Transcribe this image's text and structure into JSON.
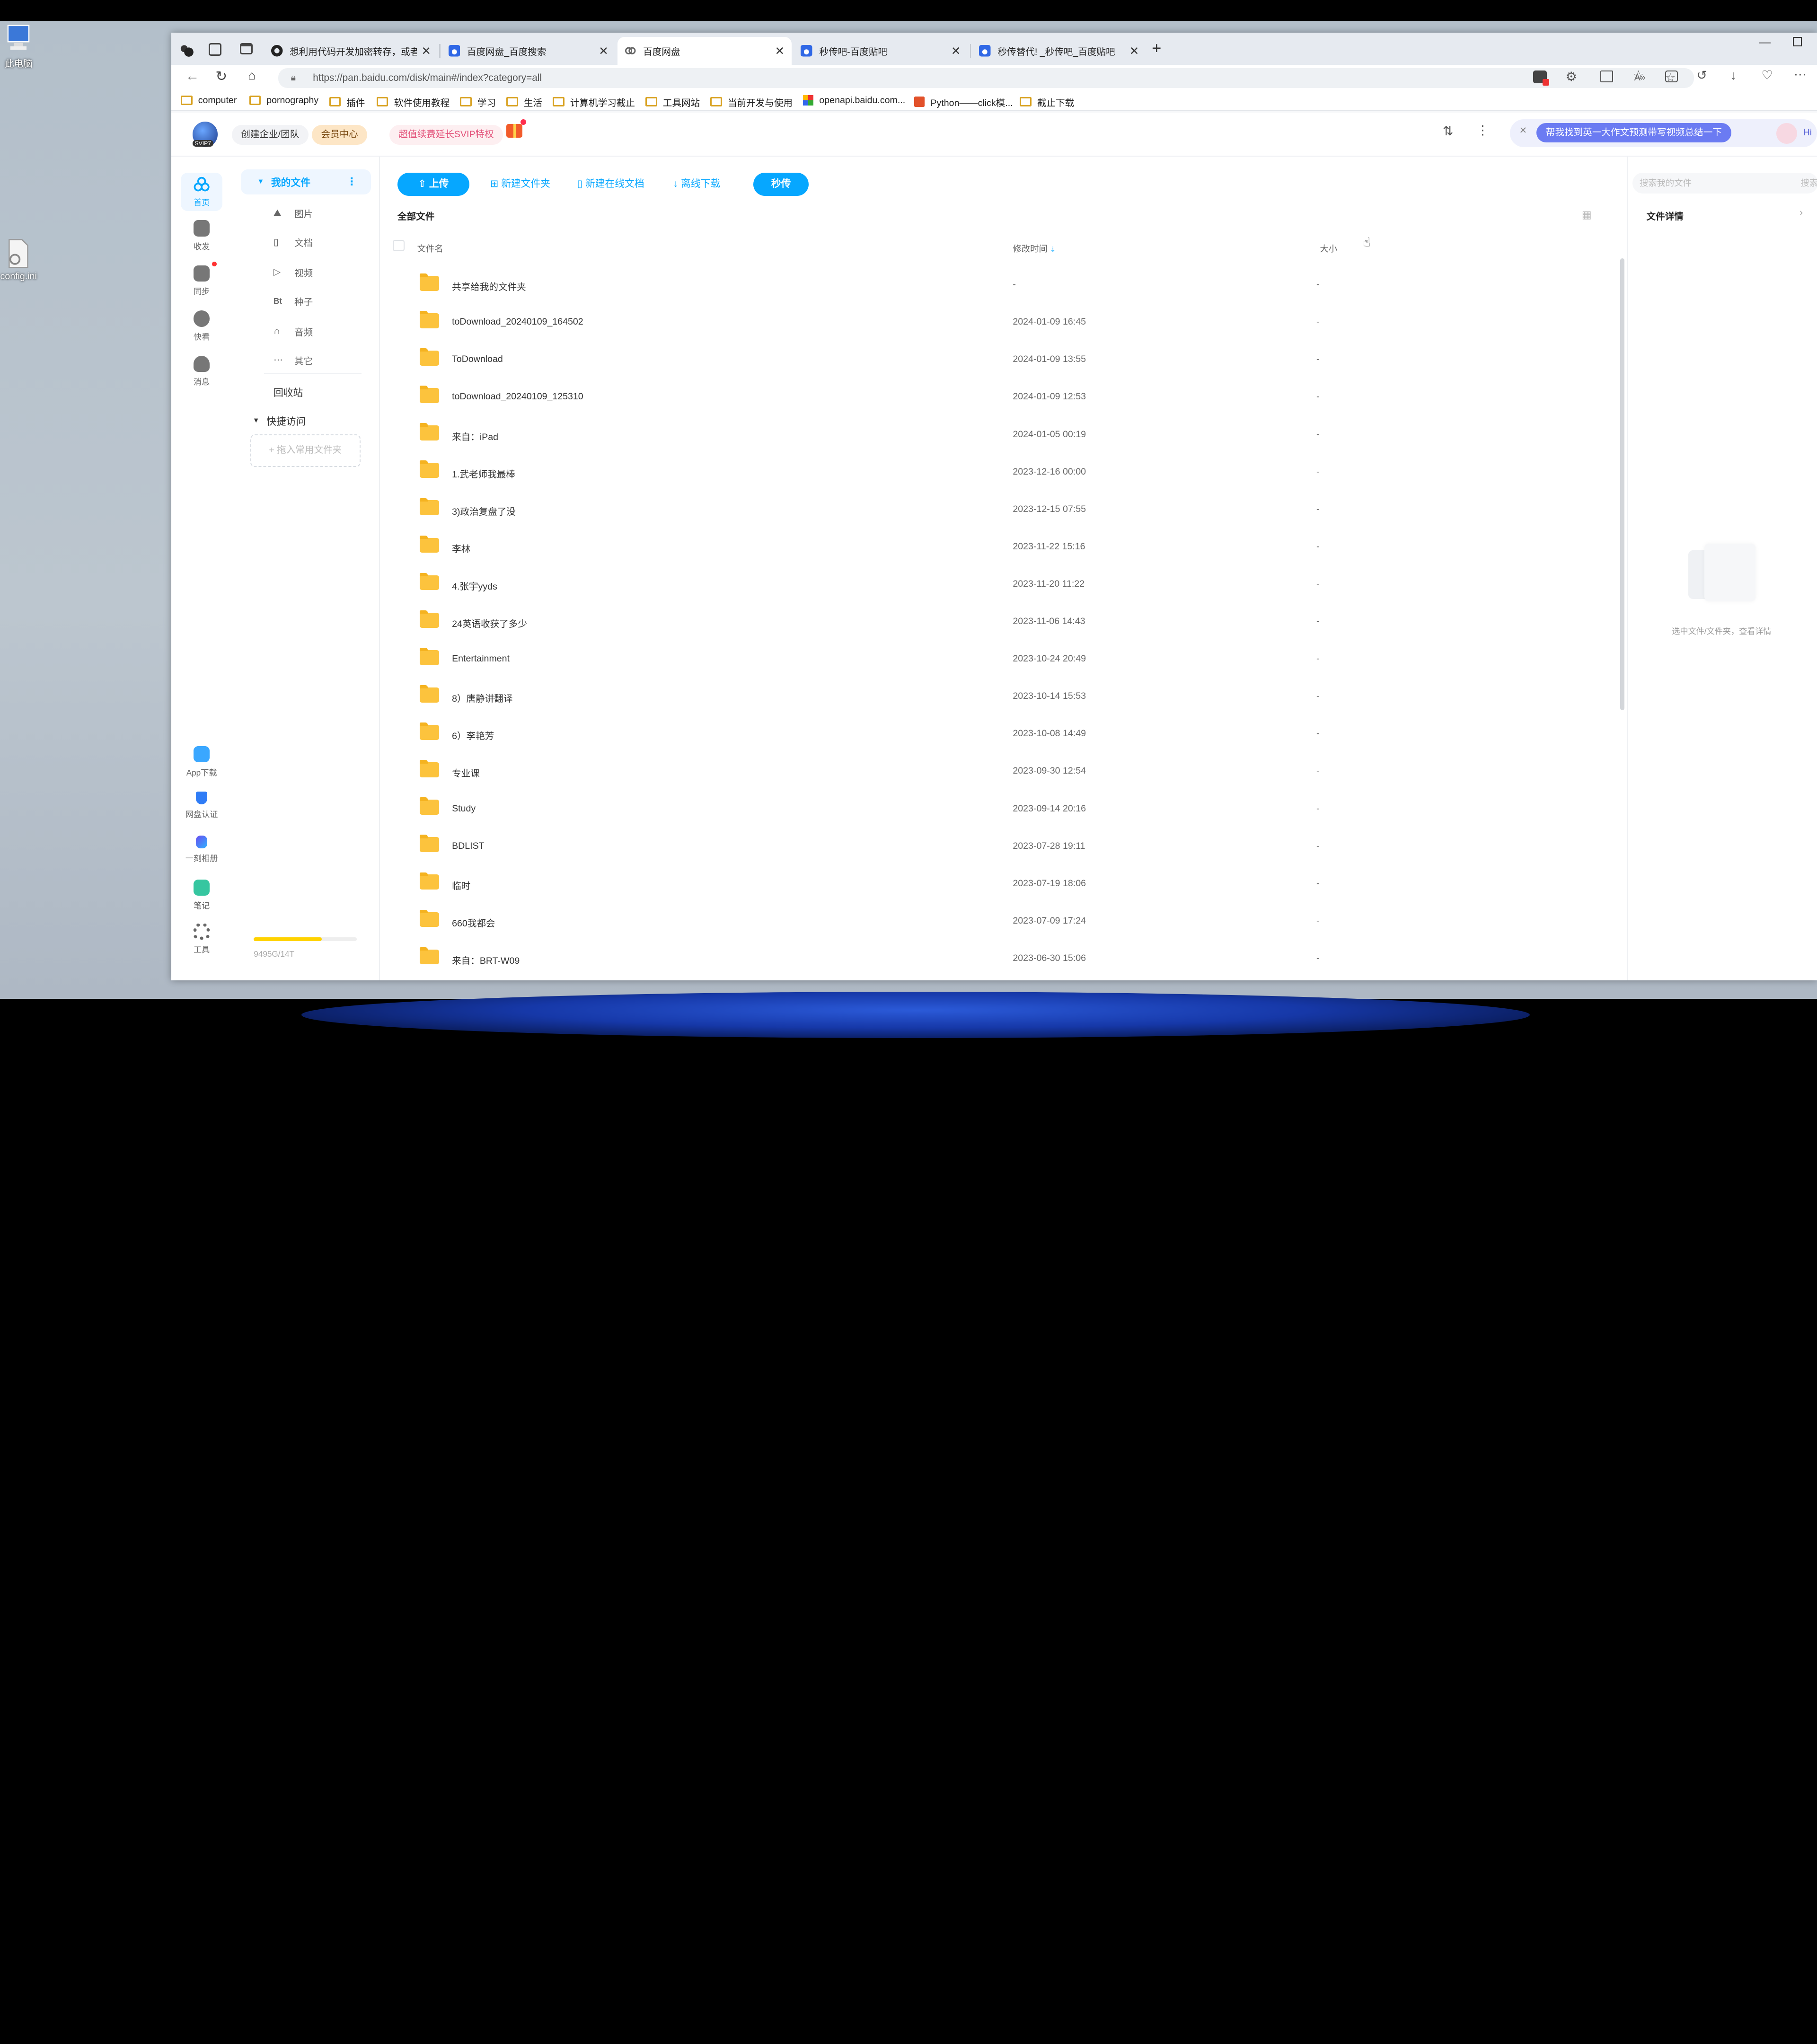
{
  "desktop": {
    "icons": [
      {
        "label": "此电脑"
      },
      {
        "label": "config.ini"
      }
    ]
  },
  "browser": {
    "tabs": [
      {
        "title": "想利用代码开发加密转存，或者",
        "icon": "github-icon"
      },
      {
        "title": "百度网盘_百度搜索",
        "icon": "baidu-paw-icon"
      },
      {
        "title": "百度网盘",
        "icon": "baidu-netdisk-icon",
        "active": true
      },
      {
        "title": "秒传吧-百度贴吧",
        "icon": "baidu-paw-icon"
      },
      {
        "title": "秒传替代! _秒传吧_百度贴吧",
        "icon": "baidu-paw-icon"
      }
    ],
    "url": "https://pan.baidu.com/disk/main#/index?category=all",
    "bookmarks": [
      "computer",
      "pornography",
      "插件",
      "软件使用教程",
      "学习",
      "生活",
      "计算机学习截止",
      "工具网站",
      "当前开发与使用",
      "openapi.baidu.com...",
      "Python——click模...",
      "截止下载"
    ]
  },
  "app": {
    "header": {
      "avatar_badge": "SVIP7",
      "create_team": "创建企业/团队",
      "member_center": "会员中心",
      "promo": "超值续费延长SVIP特权",
      "assistant_prompt": "帮我找到英一大作文预测带写视频总结一下",
      "hi": "Hi"
    },
    "rail": [
      {
        "label": "首页",
        "active": true
      },
      {
        "label": "收发"
      },
      {
        "label": "同步"
      },
      {
        "label": "快看"
      },
      {
        "label": "消息"
      }
    ],
    "rail_bottom": [
      {
        "label": "App下载"
      },
      {
        "label": "网盘认证"
      },
      {
        "label": "一刻相册"
      },
      {
        "label": "笔记"
      },
      {
        "label": "工具"
      }
    ],
    "sidebar": {
      "my_files": "我的文件",
      "categories": [
        {
          "label": "图片",
          "icon": "image-icon"
        },
        {
          "label": "文档",
          "icon": "document-icon"
        },
        {
          "label": "视频",
          "icon": "video-icon"
        },
        {
          "label": "种子",
          "icon": "bt-icon",
          "glyph": "Bt"
        },
        {
          "label": "音频",
          "icon": "audio-icon"
        },
        {
          "label": "其它",
          "icon": "more-icon"
        }
      ],
      "recycle": "回收站",
      "quick_access": "快捷访问",
      "drop_hint": "+ 拖入常用文件夹",
      "storage_text": "9495G/14T",
      "storage_ratio": 0.66
    },
    "toolbar": {
      "upload": "上传",
      "new_folder": "新建文件夹",
      "new_doc": "新建在线文档",
      "offline": "离线下载",
      "rapid": "秒传"
    },
    "breadcrumb": "全部文件",
    "columns": {
      "name": "文件名",
      "time": "修改时间",
      "size": "大小"
    },
    "files": [
      {
        "name": "共享给我的文件夹",
        "time": "-",
        "size": "-",
        "shared": true
      },
      {
        "name": "toDownload_20240109_164502",
        "time": "2024-01-09 16:45",
        "size": "-"
      },
      {
        "name": "ToDownload",
        "time": "2024-01-09 13:55",
        "size": "-"
      },
      {
        "name": "toDownload_20240109_125310",
        "time": "2024-01-09 12:53",
        "size": "-"
      },
      {
        "name": "来自：iPad",
        "time": "2024-01-05 00:19",
        "size": "-"
      },
      {
        "name": "1.武老师我最棒",
        "time": "2023-12-16 00:00",
        "size": "-"
      },
      {
        "name": "3)政治复盘了没",
        "time": "2023-12-15 07:55",
        "size": "-"
      },
      {
        "name": "李林",
        "time": "2023-11-22 15:16",
        "size": "-"
      },
      {
        "name": "4.张宇yyds",
        "time": "2023-11-20 11:22",
        "size": "-"
      },
      {
        "name": "24英语收获了多少",
        "time": "2023-11-06 14:43",
        "size": "-"
      },
      {
        "name": "Entertainment",
        "time": "2023-10-24 20:49",
        "size": "-"
      },
      {
        "name": "8）唐静讲翻译",
        "time": "2023-10-14 15:53",
        "size": "-"
      },
      {
        "name": "6）李艳芳",
        "time": "2023-10-08 14:49",
        "size": "-"
      },
      {
        "name": "专业课",
        "time": "2023-09-30 12:54",
        "size": "-"
      },
      {
        "name": "Study",
        "time": "2023-09-14 20:16",
        "size": "-"
      },
      {
        "name": "BDLIST",
        "time": "2023-07-28 19:11",
        "size": "-"
      },
      {
        "name": "临时",
        "time": "2023-07-19 18:06",
        "size": "-"
      },
      {
        "name": "660我都会",
        "time": "2023-07-09 17:24",
        "size": "-"
      },
      {
        "name": "来自：BRT-W09",
        "time": "2023-06-30 15:06",
        "size": "-"
      }
    ],
    "detail": {
      "search_placeholder": "搜索我的文件",
      "search_btn": "搜索",
      "title": "文件详情",
      "empty_text": "选中文件/文件夹，查看详情"
    },
    "colors": {
      "brand": "#06a7ff",
      "folder": "#fcc33d",
      "assistant": "#6b7bf2"
    }
  }
}
